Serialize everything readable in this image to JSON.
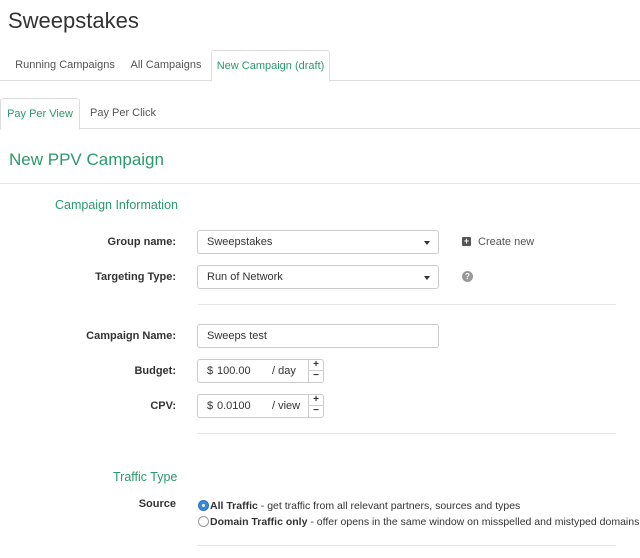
{
  "page": {
    "title": "Sweepstakes"
  },
  "top_tabs": [
    {
      "label": "Running Campaigns",
      "active": false
    },
    {
      "label": "All Campaigns",
      "active": false
    },
    {
      "label": "New Campaign (draft)",
      "active": true
    }
  ],
  "sub_tabs": [
    {
      "label": "Pay Per View",
      "active": true
    },
    {
      "label": "Pay Per Click",
      "active": false
    }
  ],
  "form": {
    "title": "New PPV Campaign",
    "campaign_info": {
      "section_title": "Campaign Information",
      "group_name": {
        "label": "Group name:",
        "value": "Sweepstakes"
      },
      "create_new_label": "Create new",
      "targeting_type": {
        "label": "Targeting Type:",
        "value": "Run of Network"
      }
    },
    "campaign_name": {
      "label": "Campaign Name:",
      "value": "Sweeps test"
    },
    "budget": {
      "label": "Budget:",
      "currency": "$",
      "value": "100.00",
      "unit": "/ day"
    },
    "cpv": {
      "label": "CPV:",
      "currency": "$",
      "value": "0.0100",
      "unit": "/ view"
    },
    "stepper": {
      "plus": "+",
      "minus": "−"
    },
    "traffic_type": {
      "section_title": "Traffic Type",
      "source_label": "Source",
      "options": [
        {
          "title": "All Traffic",
          "description": "- get traffic from all relevant partners, sources and types",
          "checked": true
        },
        {
          "title": "Domain Traffic only",
          "description": "- offer opens in the same window on misspelled and mistyped domains",
          "checked": false
        }
      ]
    }
  },
  "icons": {
    "plus_box": "+",
    "help": "?"
  },
  "colors": {
    "accent": "#2a9a6a",
    "radio_checked": "#3a87e0"
  }
}
